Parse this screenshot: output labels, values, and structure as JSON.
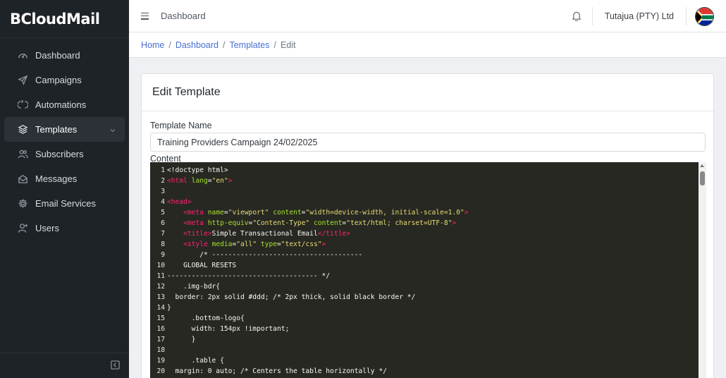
{
  "sidebar": {
    "brand": "BCloudMail",
    "items": [
      {
        "label": "Dashboard",
        "icon": "gauge-icon"
      },
      {
        "label": "Campaigns",
        "icon": "paper-plane-icon"
      },
      {
        "label": "Automations",
        "icon": "loop-icon"
      },
      {
        "label": "Templates",
        "icon": "layers-icon",
        "active": true
      },
      {
        "label": "Subscribers",
        "icon": "users-icon"
      },
      {
        "label": "Messages",
        "icon": "envelope-open-icon"
      },
      {
        "label": "Email Services",
        "icon": "gear-icon"
      },
      {
        "label": "Users",
        "icon": "user-add-icon"
      }
    ]
  },
  "header": {
    "title": "Dashboard",
    "company": "Tutajua (PTY) Ltd"
  },
  "breadcrumb": {
    "home": "Home",
    "dashboard": "Dashboard",
    "templates": "Templates",
    "current": "Edit",
    "sep": "/"
  },
  "card": {
    "title": "Edit Template",
    "name_label": "Template Name",
    "name_value": "Training Providers Campaign 24/02/2025",
    "content_label": "Content"
  },
  "code_lines": [
    {
      "n": "1",
      "parts": [
        [
          "code",
          "<!doctype html>"
        ]
      ]
    },
    {
      "n": "2",
      "parts": [
        [
          "tag",
          "<html"
        ],
        [
          "code",
          " "
        ],
        [
          "attr",
          "lang"
        ],
        [
          "code",
          "="
        ],
        [
          "str",
          "\"en\""
        ],
        [
          "tag",
          ">"
        ]
      ]
    },
    {
      "n": "3",
      "parts": []
    },
    {
      "n": "4",
      "parts": [
        [
          "tag",
          "<head>"
        ]
      ]
    },
    {
      "n": "5",
      "parts": [
        [
          "code",
          "    "
        ],
        [
          "tag",
          "<meta"
        ],
        [
          "code",
          " "
        ],
        [
          "attr",
          "name"
        ],
        [
          "code",
          "="
        ],
        [
          "str",
          "\"viewport\""
        ],
        [
          "code",
          " "
        ],
        [
          "attr",
          "content"
        ],
        [
          "code",
          "="
        ],
        [
          "str",
          "\"width=device-width, initial-scale=1.0\""
        ],
        [
          "tag",
          ">"
        ]
      ]
    },
    {
      "n": "6",
      "parts": [
        [
          "code",
          "    "
        ],
        [
          "tag",
          "<meta"
        ],
        [
          "code",
          " "
        ],
        [
          "attr",
          "http-equiv"
        ],
        [
          "code",
          "="
        ],
        [
          "str",
          "\"Content-Type\""
        ],
        [
          "code",
          " "
        ],
        [
          "attr",
          "content"
        ],
        [
          "code",
          "="
        ],
        [
          "str",
          "\"text/html; charset=UTF-8\""
        ],
        [
          "tag",
          ">"
        ]
      ]
    },
    {
      "n": "7",
      "parts": [
        [
          "code",
          "    "
        ],
        [
          "tag",
          "<title>"
        ],
        [
          "code",
          "Simple Transactional Email"
        ],
        [
          "tag",
          "</title>"
        ]
      ]
    },
    {
      "n": "8",
      "parts": [
        [
          "code",
          "    "
        ],
        [
          "tag",
          "<style"
        ],
        [
          "code",
          " "
        ],
        [
          "attr",
          "media"
        ],
        [
          "code",
          "="
        ],
        [
          "str",
          "\"all\""
        ],
        [
          "code",
          " "
        ],
        [
          "attr",
          "type"
        ],
        [
          "code",
          "="
        ],
        [
          "str",
          "\"text/css\""
        ],
        [
          "tag",
          ">"
        ]
      ]
    },
    {
      "n": "9",
      "parts": [
        [
          "code",
          "        /* -------------------------------------"
        ]
      ]
    },
    {
      "n": "10",
      "parts": [
        [
          "code",
          "    GLOBAL RESETS"
        ]
      ]
    },
    {
      "n": "11",
      "parts": [
        [
          "code",
          "------------------------------------- */"
        ]
      ]
    },
    {
      "n": "12",
      "parts": [
        [
          "code",
          "    .img-bdr{"
        ]
      ]
    },
    {
      "n": "13",
      "parts": [
        [
          "code",
          "  border: 2px solid #ddd; /* 2px thick, solid black border */"
        ]
      ]
    },
    {
      "n": "14",
      "parts": [
        [
          "code",
          "}"
        ]
      ]
    },
    {
      "n": "15",
      "parts": [
        [
          "code",
          "      .bottom-logo{"
        ]
      ]
    },
    {
      "n": "16",
      "parts": [
        [
          "code",
          "      width: 154px !important;"
        ]
      ]
    },
    {
      "n": "17",
      "parts": [
        [
          "code",
          "      }"
        ]
      ]
    },
    {
      "n": "18",
      "parts": []
    },
    {
      "n": "19",
      "parts": [
        [
          "code",
          "      .table {"
        ]
      ]
    },
    {
      "n": "20",
      "parts": [
        [
          "code",
          "  margin: 0 auto; /* Centers the table horizontally */"
        ]
      ]
    }
  ]
}
